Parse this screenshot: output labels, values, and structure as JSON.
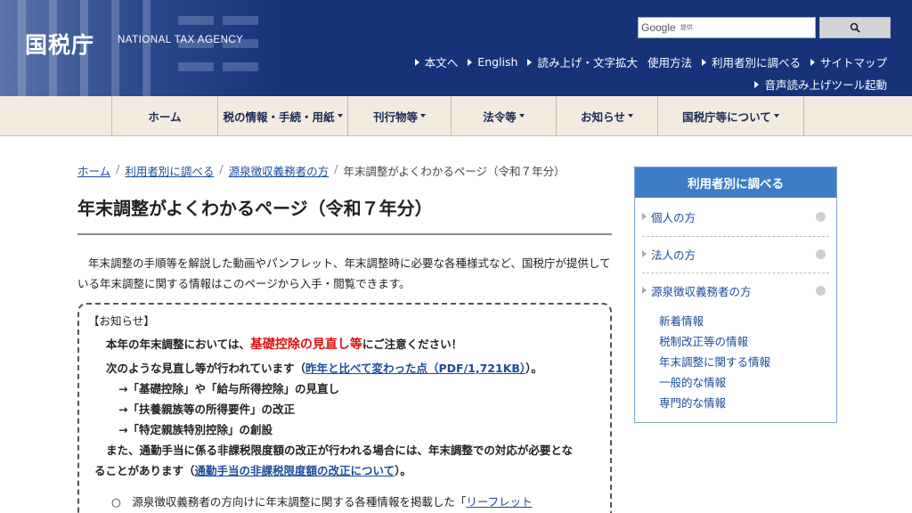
{
  "header": {
    "logo": "国税庁",
    "agency_name": "NATIONAL TAX AGENCY",
    "search": {
      "google_label": "Google",
      "provided_label": "提供",
      "button_icon": "search-icon"
    },
    "utility_links": [
      "本文へ",
      "English",
      "読み上げ・文字拡大",
      "使用方法",
      "利用者別に調べる",
      "サイトマップ"
    ],
    "voice_tool": "音声読み上げツール起動"
  },
  "global_nav": [
    {
      "label": "ホーム",
      "dropdown": false
    },
    {
      "label": "税の情報・手続・用紙",
      "dropdown": true
    },
    {
      "label": "刊行物等",
      "dropdown": true
    },
    {
      "label": "法令等",
      "dropdown": true
    },
    {
      "label": "お知らせ",
      "dropdown": true
    },
    {
      "label": "国税庁等について",
      "dropdown": true
    }
  ],
  "breadcrumb": {
    "items": [
      "ホーム",
      "利用者別に調べる",
      "源泉徴収義務者の方"
    ],
    "current": "年末調整がよくわかるページ（令和７年分）"
  },
  "page_title": "年末調整がよくわかるページ（令和７年分）",
  "intro": "年末調整の手順等を解説した動画やパンフレット、年末調整時に必要な各種様式など、国税庁が提供している年末調整に関する情報はこのページから入手・閲覧できます。",
  "notice": {
    "label": "【お知らせ】",
    "l1_pre": "本年の年末調整においては、",
    "l1_red": "基礎控除の見直し等",
    "l1_post": "にご注意ください！",
    "l2_pre": "次のような見直し等が行われています（",
    "l2_link": "昨年と比べて変わった点（PDF/1,721KB）",
    "l2_post": "）。",
    "arrows": [
      "→「基礎控除」や「給与所得控除」の見直し",
      "→「扶養親族等の所得要件」の改正",
      "→「特定親族特別控除」の創設"
    ],
    "l6": "また、通勤手当に係る非課税限度額の改正が行われる場合には、年末調整での対応が必要とな",
    "l7_pre": "ることがあります（",
    "l7_link": "通勤手当の非課税限度額の改正について",
    "l7_post": "）。",
    "bullet_pre": "○　源泉徴収義務者の方向けに年末調整に関する各種情報を掲載した「",
    "bullet_link": "リーフレット"
  },
  "sidebar": {
    "title": "利用者別に調べる",
    "categories": [
      "個人の方",
      "法人の方",
      "源泉徴収義務者の方"
    ],
    "sub_items": [
      "新着情報",
      "税制改正等の情報",
      "年末調整に関する情報",
      "一般的な情報",
      "専門的な情報"
    ]
  }
}
